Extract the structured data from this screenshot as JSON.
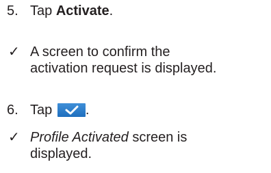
{
  "steps": [
    {
      "number": "5.",
      "prefix": "Tap ",
      "emphasis": "Activate",
      "suffix": "."
    },
    {
      "number": "6.",
      "prefix": "Tap ",
      "suffix": "."
    }
  ],
  "results": [
    {
      "check": "✓",
      "text": "A screen to confirm the activation request is displayed."
    },
    {
      "check": "✓",
      "italic": "Profile Activated",
      "text": " screen is displayed."
    }
  ],
  "icons": {
    "confirm_button": "checkmark-icon",
    "confirm_color": "#2a7ccc"
  }
}
